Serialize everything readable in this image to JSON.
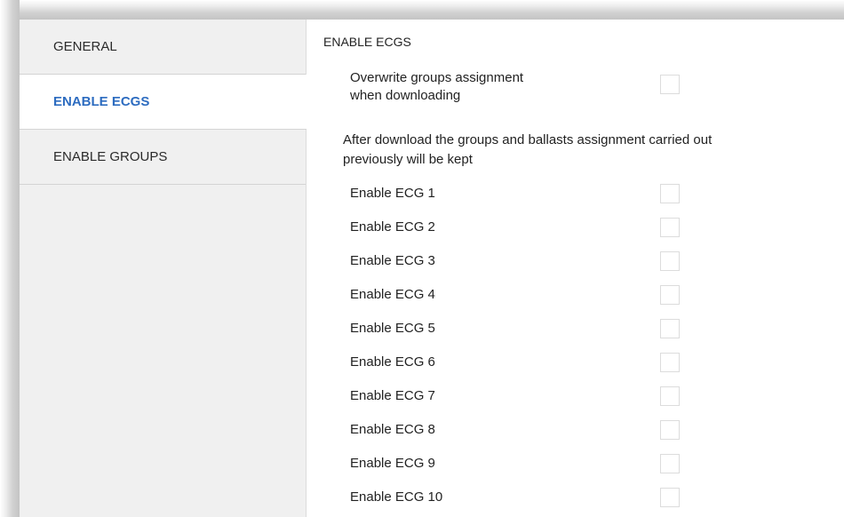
{
  "sidebar": {
    "items": [
      {
        "label": "GENERAL",
        "active": false
      },
      {
        "label": "ENABLE ECGS",
        "active": true
      },
      {
        "label": "ENABLE GROUPS",
        "active": false
      }
    ]
  },
  "main": {
    "section_title": "ENABLE ECGS",
    "overwrite": {
      "label_line1": "Overwrite groups assignment",
      "label_line2": "when downloading",
      "checked": false
    },
    "info_line1": "After download the groups and ballasts assignment carried out",
    "info_line2": "previously will be kept",
    "ecgs": [
      {
        "label": "Enable ECG 1",
        "checked": false
      },
      {
        "label": "Enable ECG 2",
        "checked": false
      },
      {
        "label": "Enable ECG 3",
        "checked": false
      },
      {
        "label": "Enable ECG 4",
        "checked": false
      },
      {
        "label": "Enable ECG 5",
        "checked": false
      },
      {
        "label": "Enable ECG 6",
        "checked": false
      },
      {
        "label": "Enable ECG 7",
        "checked": false
      },
      {
        "label": "Enable ECG 8",
        "checked": false
      },
      {
        "label": "Enable ECG 9",
        "checked": false
      },
      {
        "label": "Enable ECG 10",
        "checked": false
      }
    ]
  },
  "colors": {
    "active_tab_text": "#2d6cc0",
    "sidebar_bg": "#f0f0f0",
    "checkbox_border": "#dcdcdc"
  }
}
